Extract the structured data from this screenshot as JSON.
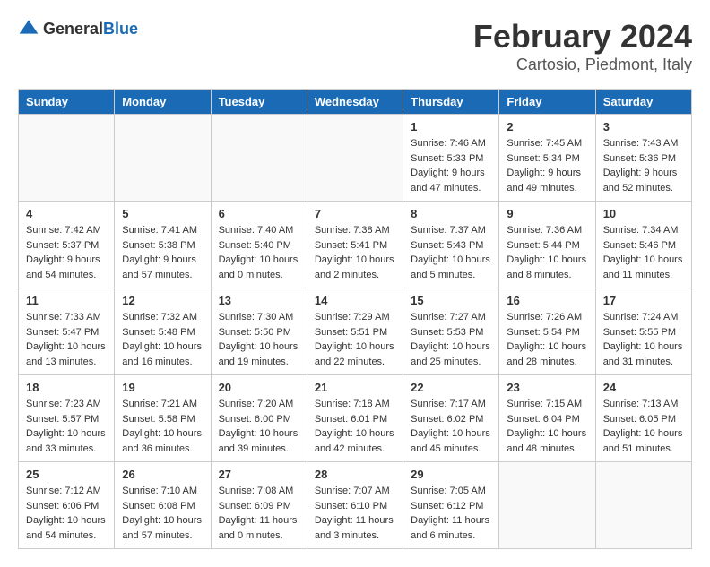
{
  "header": {
    "logo_general": "General",
    "logo_blue": "Blue",
    "month": "February 2024",
    "location": "Cartosio, Piedmont, Italy"
  },
  "weekdays": [
    "Sunday",
    "Monday",
    "Tuesday",
    "Wednesday",
    "Thursday",
    "Friday",
    "Saturday"
  ],
  "weeks": [
    [
      {
        "day": "",
        "empty": true
      },
      {
        "day": "",
        "empty": true
      },
      {
        "day": "",
        "empty": true
      },
      {
        "day": "",
        "empty": true
      },
      {
        "day": "1",
        "sunrise": "7:46 AM",
        "sunset": "5:33 PM",
        "daylight": "9 hours and 47 minutes."
      },
      {
        "day": "2",
        "sunrise": "7:45 AM",
        "sunset": "5:34 PM",
        "daylight": "9 hours and 49 minutes."
      },
      {
        "day": "3",
        "sunrise": "7:43 AM",
        "sunset": "5:36 PM",
        "daylight": "9 hours and 52 minutes."
      }
    ],
    [
      {
        "day": "4",
        "sunrise": "7:42 AM",
        "sunset": "5:37 PM",
        "daylight": "9 hours and 54 minutes."
      },
      {
        "day": "5",
        "sunrise": "7:41 AM",
        "sunset": "5:38 PM",
        "daylight": "9 hours and 57 minutes."
      },
      {
        "day": "6",
        "sunrise": "7:40 AM",
        "sunset": "5:40 PM",
        "daylight": "10 hours and 0 minutes."
      },
      {
        "day": "7",
        "sunrise": "7:38 AM",
        "sunset": "5:41 PM",
        "daylight": "10 hours and 2 minutes."
      },
      {
        "day": "8",
        "sunrise": "7:37 AM",
        "sunset": "5:43 PM",
        "daylight": "10 hours and 5 minutes."
      },
      {
        "day": "9",
        "sunrise": "7:36 AM",
        "sunset": "5:44 PM",
        "daylight": "10 hours and 8 minutes."
      },
      {
        "day": "10",
        "sunrise": "7:34 AM",
        "sunset": "5:46 PM",
        "daylight": "10 hours and 11 minutes."
      }
    ],
    [
      {
        "day": "11",
        "sunrise": "7:33 AM",
        "sunset": "5:47 PM",
        "daylight": "10 hours and 13 minutes."
      },
      {
        "day": "12",
        "sunrise": "7:32 AM",
        "sunset": "5:48 PM",
        "daylight": "10 hours and 16 minutes."
      },
      {
        "day": "13",
        "sunrise": "7:30 AM",
        "sunset": "5:50 PM",
        "daylight": "10 hours and 19 minutes."
      },
      {
        "day": "14",
        "sunrise": "7:29 AM",
        "sunset": "5:51 PM",
        "daylight": "10 hours and 22 minutes."
      },
      {
        "day": "15",
        "sunrise": "7:27 AM",
        "sunset": "5:53 PM",
        "daylight": "10 hours and 25 minutes."
      },
      {
        "day": "16",
        "sunrise": "7:26 AM",
        "sunset": "5:54 PM",
        "daylight": "10 hours and 28 minutes."
      },
      {
        "day": "17",
        "sunrise": "7:24 AM",
        "sunset": "5:55 PM",
        "daylight": "10 hours and 31 minutes."
      }
    ],
    [
      {
        "day": "18",
        "sunrise": "7:23 AM",
        "sunset": "5:57 PM",
        "daylight": "10 hours and 33 minutes."
      },
      {
        "day": "19",
        "sunrise": "7:21 AM",
        "sunset": "5:58 PM",
        "daylight": "10 hours and 36 minutes."
      },
      {
        "day": "20",
        "sunrise": "7:20 AM",
        "sunset": "6:00 PM",
        "daylight": "10 hours and 39 minutes."
      },
      {
        "day": "21",
        "sunrise": "7:18 AM",
        "sunset": "6:01 PM",
        "daylight": "10 hours and 42 minutes."
      },
      {
        "day": "22",
        "sunrise": "7:17 AM",
        "sunset": "6:02 PM",
        "daylight": "10 hours and 45 minutes."
      },
      {
        "day": "23",
        "sunrise": "7:15 AM",
        "sunset": "6:04 PM",
        "daylight": "10 hours and 48 minutes."
      },
      {
        "day": "24",
        "sunrise": "7:13 AM",
        "sunset": "6:05 PM",
        "daylight": "10 hours and 51 minutes."
      }
    ],
    [
      {
        "day": "25",
        "sunrise": "7:12 AM",
        "sunset": "6:06 PM",
        "daylight": "10 hours and 54 minutes."
      },
      {
        "day": "26",
        "sunrise": "7:10 AM",
        "sunset": "6:08 PM",
        "daylight": "10 hours and 57 minutes."
      },
      {
        "day": "27",
        "sunrise": "7:08 AM",
        "sunset": "6:09 PM",
        "daylight": "11 hours and 0 minutes."
      },
      {
        "day": "28",
        "sunrise": "7:07 AM",
        "sunset": "6:10 PM",
        "daylight": "11 hours and 3 minutes."
      },
      {
        "day": "29",
        "sunrise": "7:05 AM",
        "sunset": "6:12 PM",
        "daylight": "11 hours and 6 minutes."
      },
      {
        "day": "",
        "empty": true
      },
      {
        "day": "",
        "empty": true
      }
    ]
  ]
}
